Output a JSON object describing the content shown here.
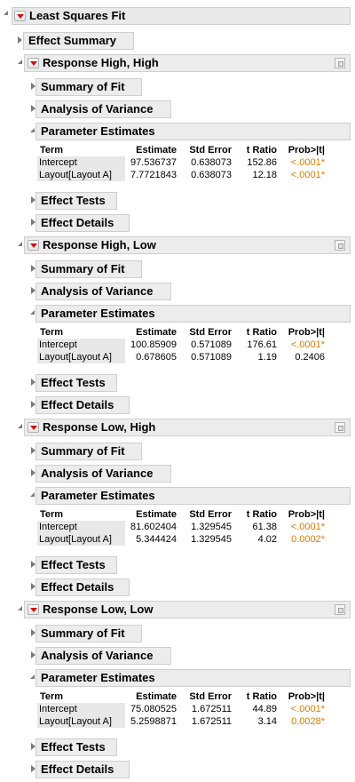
{
  "report": {
    "title": "Least Squares Fit",
    "effect_summary": "Effect Summary",
    "responses": [
      {
        "title": "Response High, High",
        "summary_of_fit": "Summary of Fit",
        "analysis_of_variance": "Analysis of Variance",
        "parameter_estimates": "Parameter Estimates",
        "columns": [
          "Term",
          "Estimate",
          "Std Error",
          "t Ratio",
          "Prob>|t|"
        ],
        "rows": [
          {
            "term": "Intercept",
            "estimate": "97.536737",
            "std_error": "0.638073",
            "t_ratio": "152.86",
            "prob": "<.0001*"
          },
          {
            "term": "Layout[Layout A]",
            "estimate": "7.7721843",
            "std_error": "0.638073",
            "t_ratio": "12.18",
            "prob": "<.0001*"
          }
        ],
        "effect_tests": "Effect Tests",
        "effect_details": "Effect Details"
      },
      {
        "title": "Response High, Low",
        "summary_of_fit": "Summary of Fit",
        "analysis_of_variance": "Analysis of Variance",
        "parameter_estimates": "Parameter Estimates",
        "columns": [
          "Term",
          "Estimate",
          "Std Error",
          "t Ratio",
          "Prob>|t|"
        ],
        "rows": [
          {
            "term": "Intercept",
            "estimate": "100.85909",
            "std_error": "0.571089",
            "t_ratio": "176.61",
            "prob": "<.0001*"
          },
          {
            "term": "Layout[Layout A]",
            "estimate": "0.678605",
            "std_error": "0.571089",
            "t_ratio": "1.19",
            "prob": "0.2406"
          }
        ],
        "effect_tests": "Effect Tests",
        "effect_details": "Effect Details"
      },
      {
        "title": "Response Low, High",
        "summary_of_fit": "Summary of Fit",
        "analysis_of_variance": "Analysis of Variance",
        "parameter_estimates": "Parameter Estimates",
        "columns": [
          "Term",
          "Estimate",
          "Std Error",
          "t Ratio",
          "Prob>|t|"
        ],
        "rows": [
          {
            "term": "Intercept",
            "estimate": "81.602404",
            "std_error": "1.329545",
            "t_ratio": "61.38",
            "prob": "<.0001*"
          },
          {
            "term": "Layout[Layout A]",
            "estimate": "5.344424",
            "std_error": "1.329545",
            "t_ratio": "4.02",
            "prob": "0.0002*"
          }
        ],
        "effect_tests": "Effect Tests",
        "effect_details": "Effect Details"
      },
      {
        "title": "Response Low, Low",
        "summary_of_fit": "Summary of Fit",
        "analysis_of_variance": "Analysis of Variance",
        "parameter_estimates": "Parameter Estimates",
        "columns": [
          "Term",
          "Estimate",
          "Std Error",
          "t Ratio",
          "Prob>|t|"
        ],
        "rows": [
          {
            "term": "Intercept",
            "estimate": "75.080525",
            "std_error": "1.672511",
            "t_ratio": "44.89",
            "prob": "<.0001*"
          },
          {
            "term": "Layout[Layout A]",
            "estimate": "5.2598871",
            "std_error": "1.672511",
            "t_ratio": "3.14",
            "prob": "0.0028*"
          }
        ],
        "effect_tests": "Effect Tests",
        "effect_details": "Effect Details"
      }
    ]
  },
  "colors": {
    "significant_p": "#e07b00",
    "menu_arrow": "#d01010",
    "header_bg": "#ececec",
    "term_bg": "#e8e8e8"
  },
  "icons": {
    "disclosure_open": "disclosure-open-icon",
    "disclosure_closed": "disclosure-closed-icon",
    "red_triangle_menu": "red-triangle-menu-icon",
    "pin": "pin-icon"
  }
}
